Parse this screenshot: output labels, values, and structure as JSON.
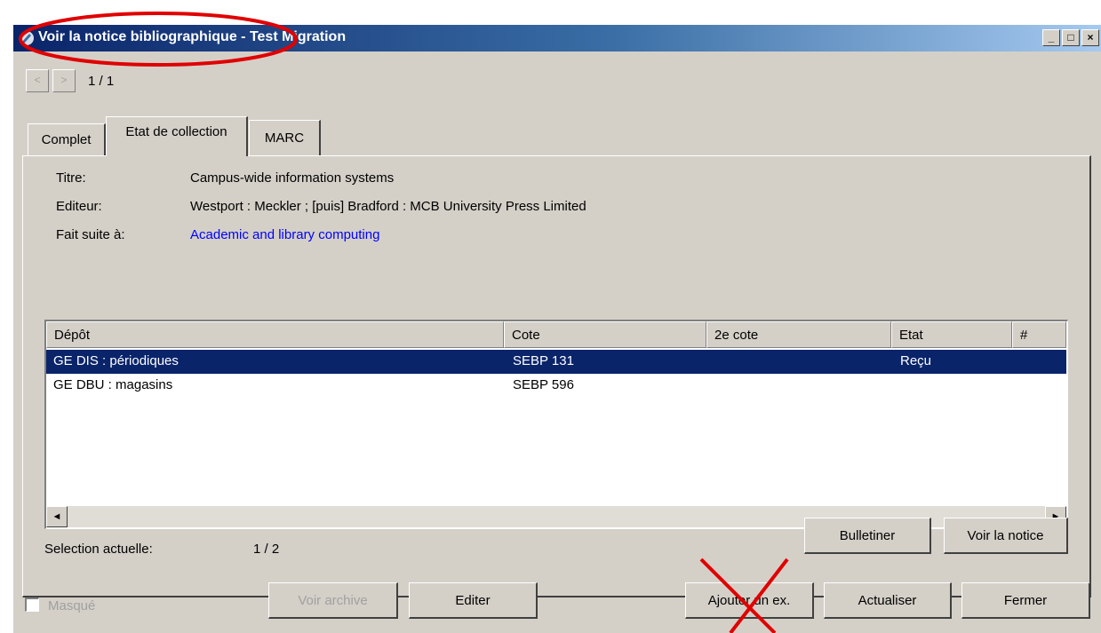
{
  "window": {
    "title": "Voir la notice bibliographique - Test Migration",
    "controls": {
      "minimize": "_",
      "maximize": "□",
      "close": "×"
    }
  },
  "nav": {
    "prev": "<",
    "next": ">",
    "page": "1 / 1"
  },
  "tabs": [
    {
      "label": "Complet",
      "active": false
    },
    {
      "label": "Etat de collection",
      "active": true
    },
    {
      "label": "MARC",
      "active": false
    }
  ],
  "record": {
    "title_label": "Titre:",
    "title_value": "Campus-wide information systems",
    "publisher_label": "Editeur:",
    "publisher_value": "Westport : Meckler ; [puis] Bradford : MCB University Press Limited",
    "continues_label": "Fait suite à:",
    "continues_value": "Academic and library computing"
  },
  "table": {
    "columns": [
      "Dépôt",
      "Cote",
      "2e cote",
      "Etat",
      "#"
    ],
    "rows": [
      {
        "depot": "GE DIS : périodiques",
        "cote": "SEBP 131",
        "cote2": "",
        "etat": "Reçu",
        "num": "",
        "selected": true
      },
      {
        "depot": "GE DBU : magasins",
        "cote": "SEBP 596",
        "cote2": "",
        "etat": "",
        "num": "",
        "selected": false
      }
    ],
    "scroll_left": "◄",
    "scroll_right": "►"
  },
  "selection": {
    "label": "Selection actuelle:",
    "value": "1 / 2"
  },
  "panel_buttons": {
    "bulletiner": "Bulletiner",
    "voir_notice": "Voir la notice"
  },
  "footer": {
    "masque_label": "Masqué",
    "voir_archive": "Voir archive",
    "editer": "Editer",
    "ajouter": "Ajouter un ex.",
    "actualiser": "Actualiser",
    "fermer": "Fermer"
  },
  "colors": {
    "selection": "#0a246a",
    "link": "#0000ff",
    "annotation": "#e00000",
    "face": "#d4d0c8"
  }
}
